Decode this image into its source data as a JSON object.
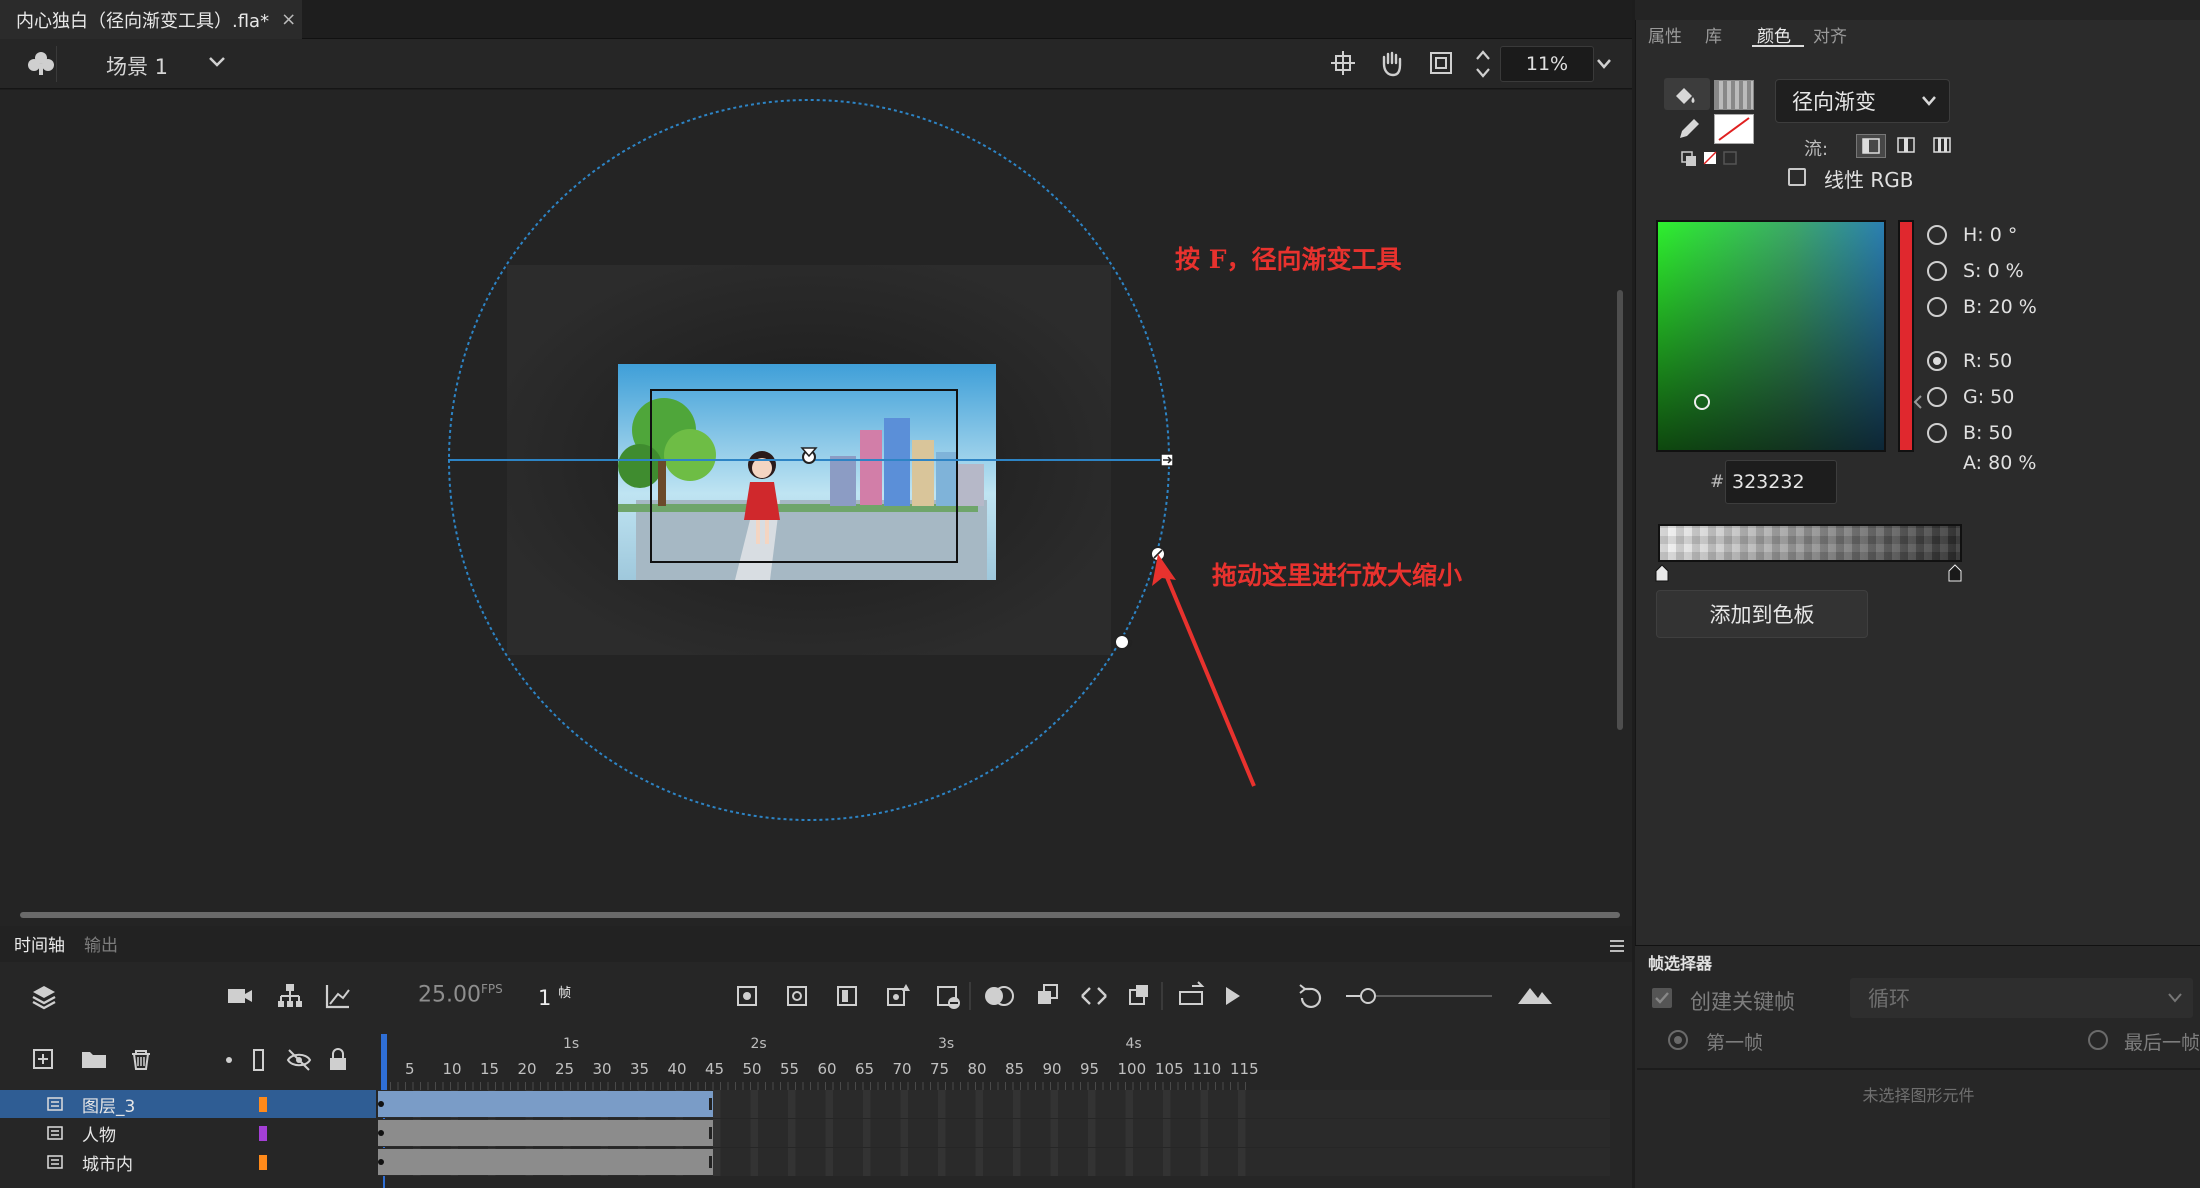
{
  "document": {
    "tab_title": "内心独白（径向渐变工具）.fla*",
    "close_glyph": "×"
  },
  "editbar": {
    "scene_label": "场景 1",
    "zoom_value": "11%"
  },
  "annotations": {
    "top": "按 F，径向渐变工具",
    "arrow": "拖动这里进行放大缩小",
    "color": "#e8322e"
  },
  "right_panel": {
    "tabs": [
      "属性",
      "库",
      "颜色",
      "对齐"
    ],
    "active_tab": "颜色",
    "fill_type": "径向渐变",
    "flow_label": "流:",
    "linear_rgb_label": "线性 RGB",
    "hsb": [
      {
        "label": "H:",
        "value": "0",
        "unit": "°"
      },
      {
        "label": "S:",
        "value": "0",
        "unit": "%"
      },
      {
        "label": "B:",
        "value": "20",
        "unit": "%"
      }
    ],
    "rgb": [
      {
        "label": "R:",
        "value": "50"
      },
      {
        "label": "G:",
        "value": "50"
      },
      {
        "label": "B:",
        "value": "50"
      }
    ],
    "alpha": {
      "label": "A:",
      "value": "80",
      "unit": "%"
    },
    "hex_prefix": "#",
    "hex_value": "323232",
    "add_swatch_button": "添加到色板",
    "colors": {
      "picker_hue": "#2ef02e",
      "hue_bar": "#e0282e"
    }
  },
  "timeline": {
    "tabs": [
      "时间轴",
      "输出"
    ],
    "fps_value": "25.00",
    "fps_unit": "FPS",
    "frame_value": "1",
    "frame_unit": "帧",
    "seconds": [
      "1s",
      "2s",
      "3s",
      "4s"
    ],
    "frame_numbers": [
      "5",
      "10",
      "15",
      "20",
      "25",
      "30",
      "35",
      "40",
      "45",
      "50",
      "55",
      "60",
      "65",
      "70",
      "75",
      "80",
      "85",
      "90",
      "95",
      "100",
      "105",
      "110",
      "115"
    ],
    "layers": [
      {
        "name": "图层_3",
        "color": "#ff8a1a",
        "selected": true
      },
      {
        "name": "人物",
        "color": "#a43fd6",
        "selected": false
      },
      {
        "name": "城市内",
        "color": "#ff8a1a",
        "selected": false
      }
    ],
    "span_end_frame": 44
  },
  "frame_picker": {
    "title": "帧选择器",
    "create_keyframe_label": "创建关键帧",
    "loop_value": "循环",
    "first_frame_label": "第一帧",
    "last_frame_label": "最后一帧",
    "empty_message": "未选择图形元件"
  }
}
